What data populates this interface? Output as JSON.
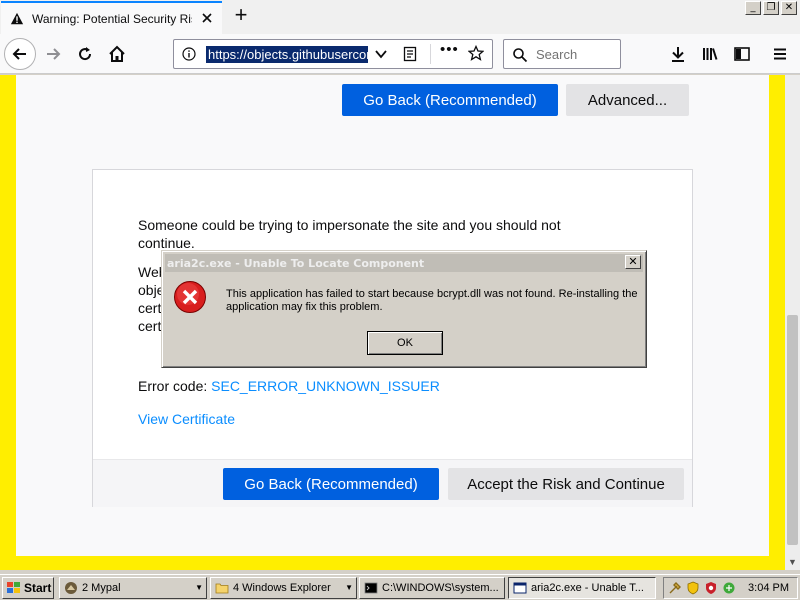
{
  "browser": {
    "tab_title": "Warning: Potential Security Risk Ahead",
    "new_tab_label": "+",
    "url": "https://objects.githubusercontent.com",
    "search_placeholder": "Search",
    "more_label": "•••",
    "window_buttons": [
      "_",
      "❐",
      "✕"
    ]
  },
  "page": {
    "top_buttons": {
      "go_back": "Go Back (Recommended)",
      "advanced": "Advanced..."
    },
    "card": {
      "paragraph1": "Someone could be trying to impersonate the site and you should not continue.",
      "fragment_lines": [
        "Web",
        "obje",
        "cert",
        "cert"
      ],
      "error_code_label": "Error code:",
      "error_code_value": "SEC_ERROR_UNKNOWN_ISSUER",
      "view_certificate": "View Certificate",
      "go_back": "Go Back (Recommended)",
      "accept": "Accept the Risk and Continue"
    }
  },
  "dialog": {
    "title": "aria2c.exe - Unable To Locate Component",
    "close": "✕",
    "message": "This application has failed to start because bcrypt.dll was not found. Re-installing the application may fix this problem.",
    "ok": "OK"
  },
  "taskbar": {
    "start": "Start",
    "buttons": [
      {
        "label": "2 Mypal",
        "icon": "mypal-icon"
      },
      {
        "label": "4 Windows Explorer",
        "icon": "folder-icon"
      },
      {
        "label": "C:\\WINDOWS\\system...",
        "icon": "cmd-icon"
      },
      {
        "label": "aria2c.exe - Unable T...",
        "icon": "window-icon"
      }
    ],
    "clock": "3:04 PM"
  },
  "colors": {
    "primary": "#0060df",
    "link": "#0a8dff",
    "warning_border": "#ffee00"
  }
}
